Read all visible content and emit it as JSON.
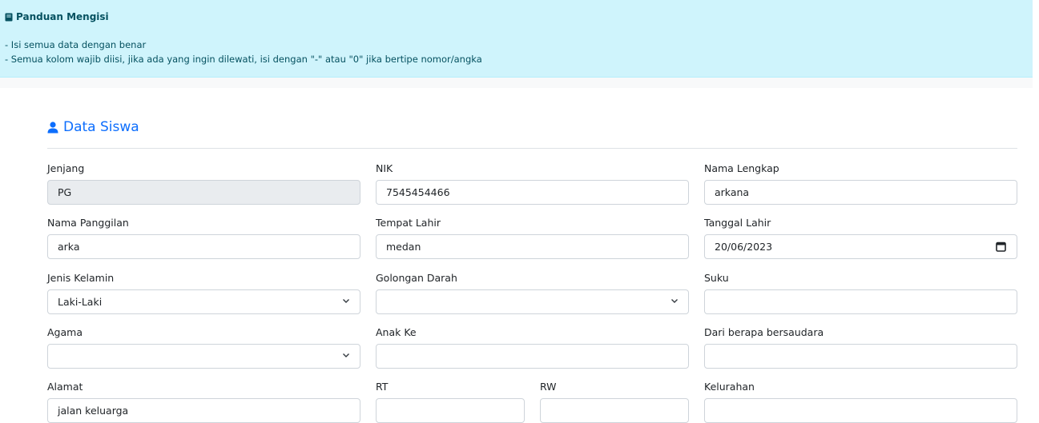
{
  "guide": {
    "title": "Panduan Mengisi",
    "line1": "- Isi semua data dengan benar",
    "line2": "- Semua kolom wajib diisi, jika ada yang ingin dilewati, isi dengan \"-\" atau \"0\" jika bertipe nomor/angka",
    "icon": "book-icon"
  },
  "section": {
    "title": "Data Siswa",
    "icon": "user-icon"
  },
  "form": {
    "jenjang": {
      "label": "Jenjang",
      "value": "PG"
    },
    "nik": {
      "label": "NIK",
      "value": "7545454466"
    },
    "nama_lengkap": {
      "label": "Nama Lengkap",
      "value": "arkana"
    },
    "nama_panggilan": {
      "label": "Nama Panggilan",
      "value": "arka"
    },
    "tempat_lahir": {
      "label": "Tempat Lahir",
      "value": "medan"
    },
    "tanggal_lahir": {
      "label": "Tanggal Lahir",
      "value": "20/06/2023"
    },
    "jenis_kelamin": {
      "label": "Jenis Kelamin",
      "value": "Laki-Laki"
    },
    "golongan_darah": {
      "label": "Golongan Darah",
      "value": ""
    },
    "suku": {
      "label": "Suku",
      "value": ""
    },
    "agama": {
      "label": "Agama",
      "value": ""
    },
    "anak_ke": {
      "label": "Anak Ke",
      "value": ""
    },
    "dari_berapa": {
      "label": "Dari berapa bersaudara",
      "value": ""
    },
    "alamat": {
      "label": "Alamat",
      "value": "jalan keluarga"
    },
    "rt": {
      "label": "RT",
      "value": ""
    },
    "rw": {
      "label": "RW",
      "value": ""
    },
    "kelurahan": {
      "label": "Kelurahan",
      "value": ""
    }
  },
  "colors": {
    "accent": "#0d6efd",
    "alert_bg": "#cff4fc",
    "alert_text": "#055160"
  }
}
